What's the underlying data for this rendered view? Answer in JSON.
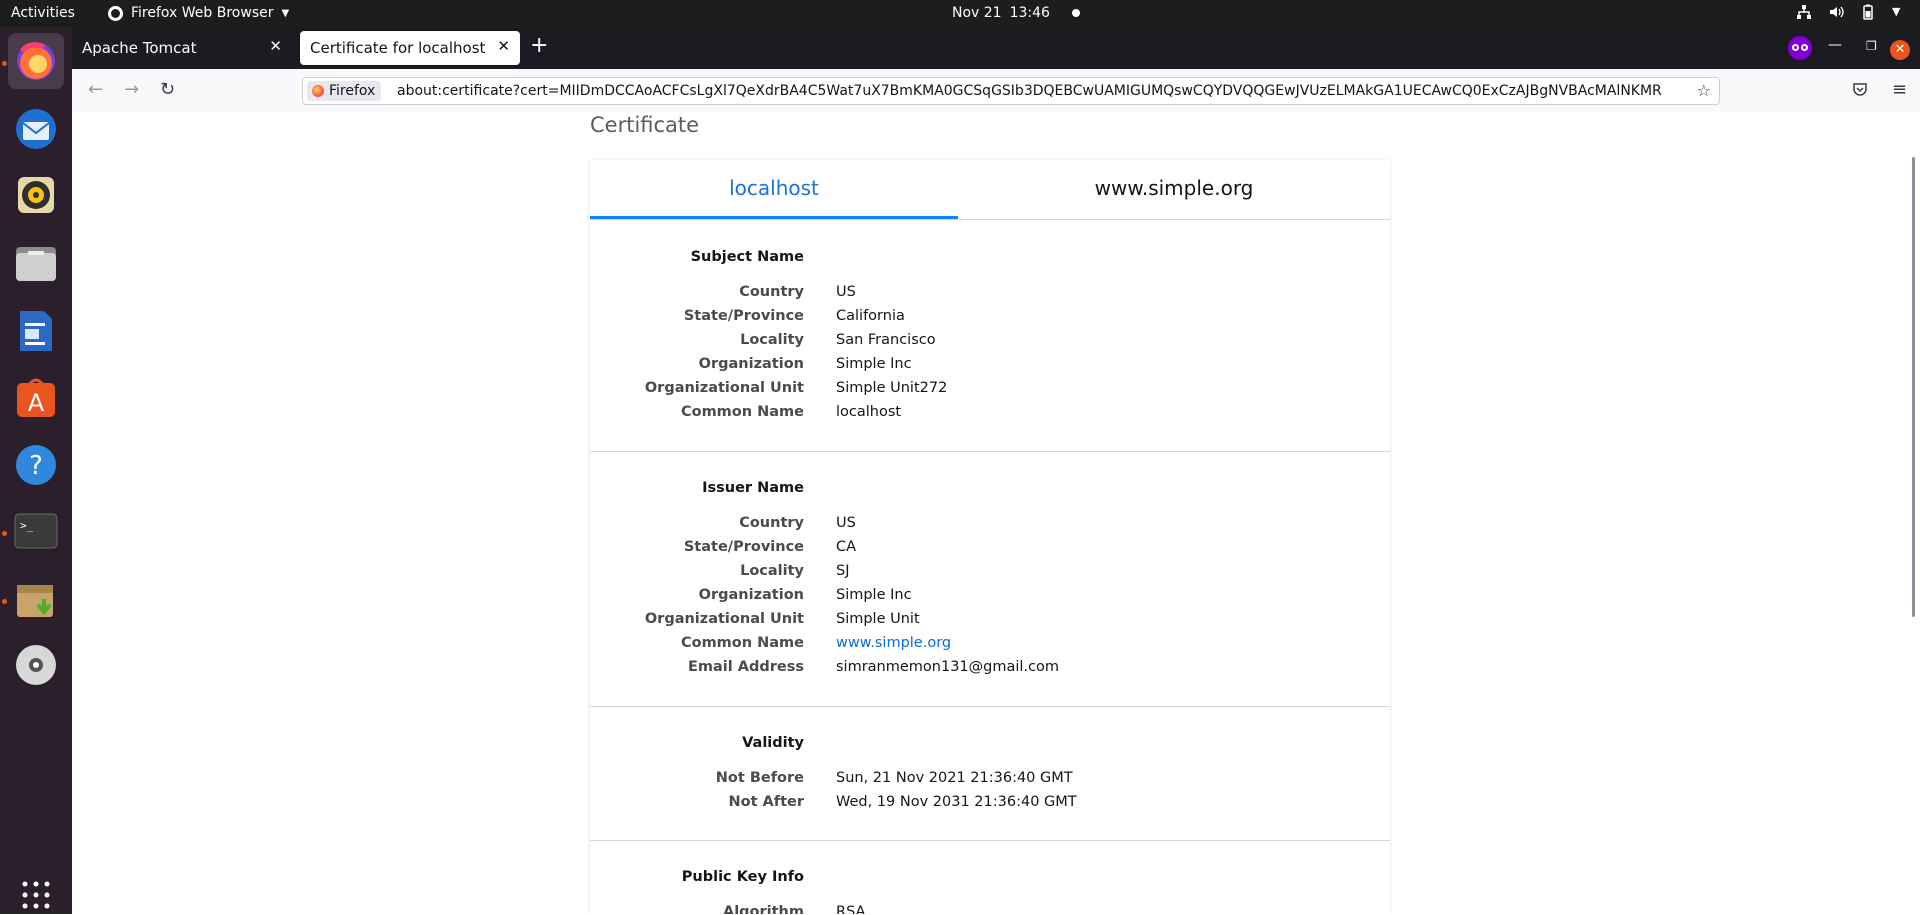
{
  "topbar": {
    "activities": "Activities",
    "app_menu": "Firefox Web Browser",
    "date": "Nov 21",
    "time": "13:46"
  },
  "dock": {
    "items": [
      "Firefox",
      "Thunderbird",
      "Rhythmbox",
      "Files",
      "LibreOffice Writer",
      "Ubuntu Software",
      "Help",
      "Terminal",
      "Archive Manager",
      "DVD Drive",
      "Show Applications"
    ]
  },
  "browser": {
    "tabs": [
      {
        "title": "Apache Tomcat",
        "active": false
      },
      {
        "title": "Certificate for localhost",
        "active": true
      }
    ],
    "identity_label": "Firefox",
    "url": "about:certificate?cert=MIIDmDCCAoACFCsLgXl7QeXdrBA4C5Wat7uX7BmKMA0GCSqGSIb3DQEBCwUAMIGUMQswCQYDVQQGEwJVUzELMAkGA1UECAwCQ0ExCzAJBgNVBAcMAlNKMR"
  },
  "page": {
    "title": "Certificate",
    "tabs": [
      "localhost",
      "www.simple.org"
    ],
    "subject": {
      "heading": "Subject Name",
      "rows": [
        {
          "label": "Country",
          "value": "US"
        },
        {
          "label": "State/Province",
          "value": "California"
        },
        {
          "label": "Locality",
          "value": "San Francisco"
        },
        {
          "label": "Organization",
          "value": "Simple Inc"
        },
        {
          "label": "Organizational Unit",
          "value": "Simple Unit272"
        },
        {
          "label": "Common Name",
          "value": "localhost"
        }
      ]
    },
    "issuer": {
      "heading": "Issuer Name",
      "rows": [
        {
          "label": "Country",
          "value": "US"
        },
        {
          "label": "State/Province",
          "value": "CA"
        },
        {
          "label": "Locality",
          "value": "SJ"
        },
        {
          "label": "Organization",
          "value": "Simple Inc"
        },
        {
          "label": "Organizational Unit",
          "value": "Simple Unit"
        },
        {
          "label": "Common Name",
          "value": "www.simple.org"
        },
        {
          "label": "Email Address",
          "value": "simranmemon131@gmail.com"
        }
      ]
    },
    "validity": {
      "heading": "Validity",
      "rows": [
        {
          "label": "Not Before",
          "value": "Sun, 21 Nov 2021 21:36:40 GMT"
        },
        {
          "label": "Not After",
          "value": "Wed, 19 Nov 2031 21:36:40 GMT"
        }
      ]
    },
    "public_key": {
      "heading": "Public Key Info",
      "rows": [
        {
          "label": "Algorithm",
          "value": "RSA"
        }
      ]
    }
  }
}
